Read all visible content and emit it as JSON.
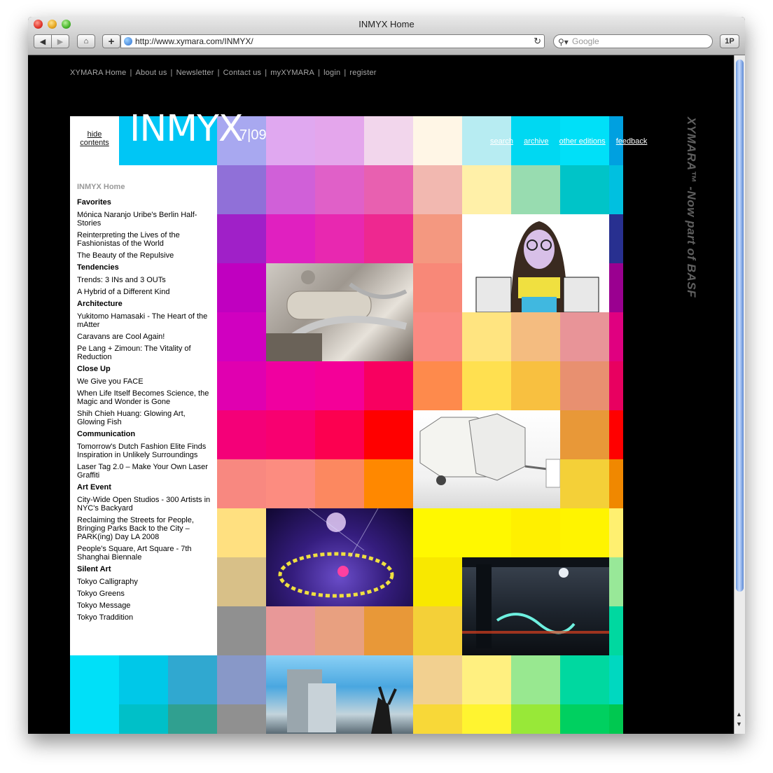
{
  "window": {
    "title": "INMYX Home",
    "url": "http://www.xymara.com/INMYX/",
    "search_placeholder": "Google",
    "onepassword_label": "1P",
    "new_tab_label": "+"
  },
  "topnav": {
    "items": [
      "XYMARA Home",
      "About us",
      "Newsletter",
      "Contact us",
      "myXYMARA",
      "login",
      "register"
    ]
  },
  "header": {
    "logo": "INMYX",
    "edition": "7|09",
    "hide_label_1": "hide",
    "hide_label_2": "contents",
    "links": [
      "search",
      "archive",
      "other editions",
      "feedback"
    ]
  },
  "sidebar": {
    "home": "INMYX Home",
    "sections": [
      {
        "heading": "Favorites",
        "items": [
          "Mónica Naranjo Uribe's Berlin Half-Stories",
          "Reinterpreting the Lives of the Fashionistas of the World",
          "The Beauty of the Repulsive"
        ]
      },
      {
        "heading": "Tendencies",
        "items": [
          "Trends: 3 INs and 3 OUTs",
          "A Hybrid of a Different Kind"
        ]
      },
      {
        "heading": "Architecture",
        "items": [
          "Yukitomo Hamasaki - The Heart of the mAtter",
          "Caravans are Cool Again!",
          "Pe Lang + Zimoun: The Vitality of Reduction"
        ]
      },
      {
        "heading": "Close Up",
        "items": [
          "We Give you FACE",
          "When Life Itself Becomes Science, the Magic and Wonder is Gone",
          "Shih Chieh Huang: Glowing Art, Glowing Fish"
        ]
      },
      {
        "heading": "Communication",
        "items": [
          "Tomorrow's Dutch Fashion Elite Finds Inspiration in Unlikely Surroundings",
          "Laser Tag 2.0 – Make Your Own Laser Graffiti"
        ]
      },
      {
        "heading": "Art Event",
        "items": [
          "City-Wide Open Studios - 300 Artists in NYC's Backyard",
          "Reclaiming the Streets for People, Bringing Parks Back to the City – PARK(ing) Day LA 2008",
          "People's Square, Art Square - 7th Shanghai Biennale"
        ]
      },
      {
        "heading": "Silent Art",
        "items": [
          "Tokyo Calligraphy",
          "Tokyo Greens",
          "Tokyo Message",
          "Tokyo Traddition"
        ]
      }
    ]
  },
  "brand_vertical": "XYMARA™ -Now part of BASF",
  "colors": {
    "grid": [
      [
        "#ffffff",
        "#00c6f5",
        "#2eaae8",
        "#a8a8f0",
        "#e0a8f0",
        "#e4a6ec",
        "#f2d6ec",
        "#fff6e6",
        "#b7ecf2",
        "#00d8f2",
        "#00e0f8",
        "#00a0e0"
      ],
      [
        "#ffffff",
        "#ffffff",
        "#ffffff",
        "#9070d8",
        "#d060d8",
        "#e060c8",
        "#e860b0",
        "#f2b8b0",
        "#fff0a8",
        "#98dcb0",
        "#00c4c8",
        "#00c0e0"
      ],
      [
        "#ffffff",
        "#ffffff",
        "#ffffff",
        "#a020c8",
        "#e020c0",
        "#e828b0",
        "#ee2890",
        "#f49880",
        "#ffffff",
        "#ffffff",
        "#30a8d0",
        "#283090"
      ],
      [
        "#ffffff",
        "#ffffff",
        "#ffffff",
        "#c000c0",
        "#ffffff",
        "#ffffff",
        "#ffffff",
        "#f88878",
        "#ffffff",
        "#ffffff",
        "#9098c8",
        "#9a0090"
      ],
      [
        "#ffffff",
        "#ffffff",
        "#ffffff",
        "#d000c0",
        "#ffffff",
        "#ffffff",
        "#ffffff",
        "#fa8a82",
        "#ffe480",
        "#f4bc80",
        "#e89498",
        "#e00080"
      ],
      [
        "#ffffff",
        "#ffffff",
        "#ffffff",
        "#e000b0",
        "#f000a0",
        "#f40098",
        "#f80060",
        "#fe8a4c",
        "#ffe050",
        "#f8c040",
        "#e89070",
        "#e80060"
      ],
      [
        "#ffffff",
        "#ffffff",
        "#ffffff",
        "#f40078",
        "#f80070",
        "#fc0050",
        "#ff0000",
        "#ffffff",
        "#ffffff",
        "#ffffff",
        "#e89838",
        "#ff0000"
      ],
      [
        "#ffffff",
        "#ffffff",
        "#ffffff",
        "#f88880",
        "#fc8c80",
        "#fc8860",
        "#ff8800",
        "#ffffff",
        "#ffffff",
        "#ffffff",
        "#f4d038",
        "#f08800"
      ],
      [
        "#ffffff",
        "#ffffff",
        "#ffffff",
        "#ffe080",
        "#ffffff",
        "#ffffff",
        "#ffffff",
        "#fff800",
        "#fff800",
        "#fff000",
        "#fff400",
        "#fff070"
      ],
      [
        "#ffffff",
        "#ffffff",
        "#ffffff",
        "#d8c088",
        "#ffffff",
        "#ffffff",
        "#ffffff",
        "#f8e800",
        "#ffffff",
        "#ffffff",
        "#ffffff",
        "#98e898"
      ],
      [
        "#ffffff",
        "#ffffff",
        "#ffffff",
        "#909090",
        "#e89898",
        "#e8a080",
        "#e89838",
        "#f4d038",
        "#ffffff",
        "#ffffff",
        "#ffffff",
        "#00d8a0"
      ],
      [
        "#00e0f8",
        "#00c8e8",
        "#30a8d0",
        "#8898c8",
        "#ffffff",
        "#ffffff",
        "#ffffff",
        "#f2d090",
        "#fff080",
        "#98e890",
        "#00d8a0",
        "#00d8c0"
      ],
      [
        "#00e0f8",
        "#00c0c8",
        "#30a090",
        "#909090",
        "#ffffff",
        "#ffffff",
        "#ffffff",
        "#f8d838",
        "#fff430",
        "#98e838",
        "#00d060",
        "#00c850"
      ]
    ]
  }
}
